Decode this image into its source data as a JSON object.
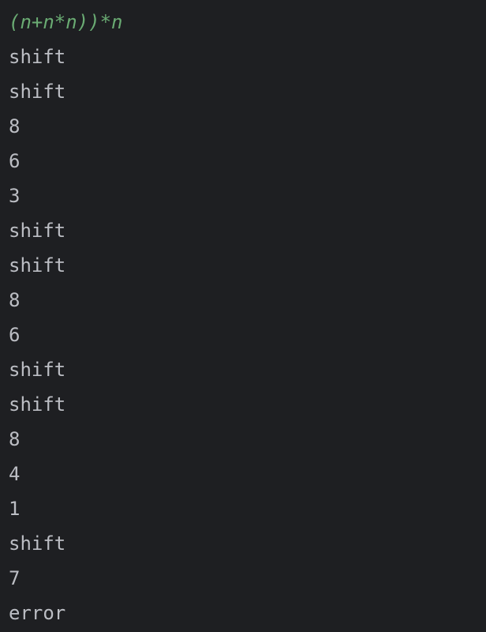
{
  "console": {
    "input": "(n+n*n))*n",
    "input_color": "#6aab73",
    "text_color": "#bcbec4",
    "background": "#1e1f22",
    "output_lines": [
      "shift",
      "shift",
      "8",
      "6",
      "3",
      "shift",
      "shift",
      "8",
      "6",
      "shift",
      "shift",
      "8",
      "4",
      "1",
      "shift",
      "7",
      "error"
    ]
  }
}
